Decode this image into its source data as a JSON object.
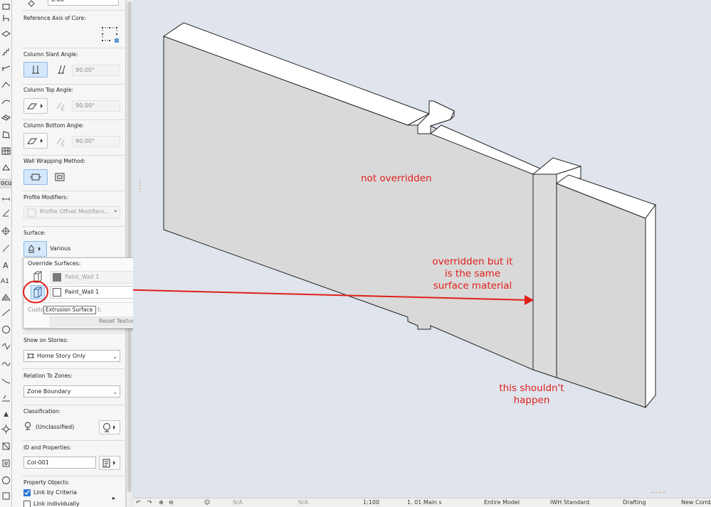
{
  "toolbox": {
    "document_tab_label": "ocumen"
  },
  "panel": {
    "top_value": "0.00",
    "reference_axis_label": "Reference Axis of Core:",
    "slant_angle_label": "Column Slant Angle:",
    "slant_angle_value": "90.00°",
    "top_angle_label": "Column Top Angle:",
    "top_angle_value": "90.00°",
    "bottom_angle_label": "Column Bottom Angle:",
    "bottom_angle_value": "90.00°",
    "wall_wrapping_label": "Wall Wrapping Method:",
    "profile_modifiers_label": "Profile Modifiers:",
    "profile_offset_button": "Profile Offset Modifiers...",
    "surface_label": "Surface:",
    "surface_value": "Various",
    "show_on_stories_label": "Show on Stories:",
    "show_on_stories_value": "Home Story Only",
    "relation_to_zones_label": "Relation To Zones:",
    "relation_to_zones_value": "Zone Boundary",
    "classification_label": "Classification:",
    "classification_value": "(Unclassified)",
    "id_properties_label": "ID and Properties:",
    "id_value": "Col-001",
    "property_objects_label": "Property Objects:",
    "link_by_criteria_label": "Link by Criteria",
    "link_individually_label": "Link individually"
  },
  "popup": {
    "title": "Override Surfaces:",
    "row1_material": "Paint_Wall 1",
    "row2_material": "Paint_Wall 1",
    "custom_label_left": "Custo",
    "custom_label_right": "t:",
    "reset_texture": "Reset Texture",
    "tooltip": "Extrusion Surface",
    "colors": {
      "row1_swatch": "#7a7a7a",
      "row2_swatch": "#ffffff",
      "highlight_circle": "#e0201b"
    }
  },
  "viewport": {
    "annotations": {
      "not_overridden": "not overridden",
      "overridden_line1": "overridden but it",
      "overridden_line2": "is the same",
      "overridden_line3": "surface material",
      "shouldnt_line1": "this shouldn't",
      "shouldnt_line2": "happen"
    },
    "colors": {
      "annotation": "#e0201b",
      "background": "#dfe4ed",
      "wall_front": "#d9d9d9",
      "wall_top": "#ffffff"
    }
  },
  "statusbar": {
    "na1": "N/A",
    "na2": "N/A",
    "scale": "1:100",
    "view": "1. 01 Main s",
    "model": "Entire Model",
    "standard": "IWH Standard",
    "drafting": "Drafting",
    "new_comb": "New Comb"
  }
}
